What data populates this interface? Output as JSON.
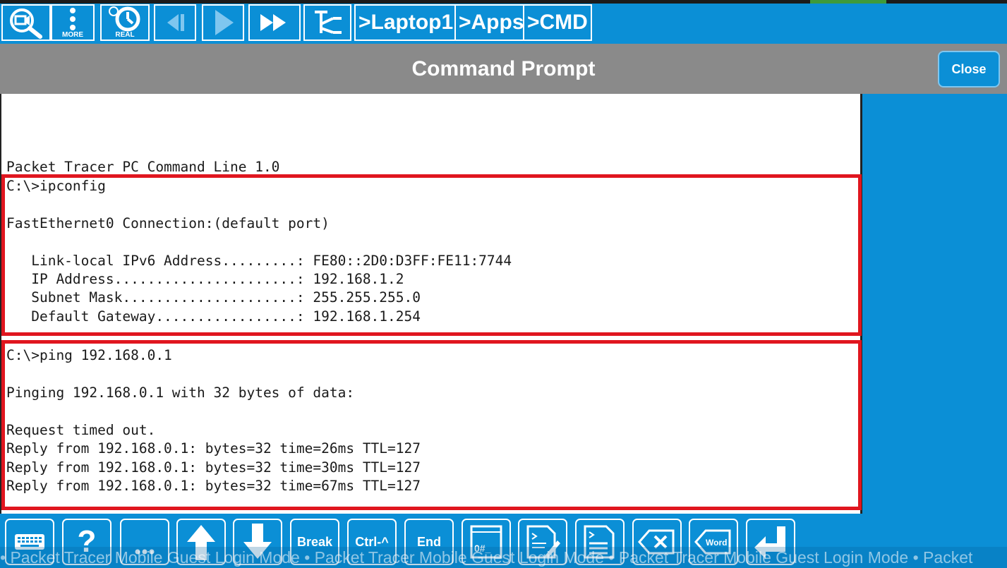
{
  "toolbar": {
    "buttons": [
      {
        "name": "inspect-button",
        "icon": "magnifier-icon"
      },
      {
        "name": "more-button",
        "icon": "vertical-dots-icon",
        "label": "MORE"
      },
      {
        "name": "realtime-button",
        "icon": "clock-icon",
        "label": "REAL"
      },
      {
        "name": "step-back-button",
        "icon": "step-back-icon"
      },
      {
        "name": "play-button",
        "icon": "play-icon"
      },
      {
        "name": "fast-forward-button",
        "icon": "fast-forward-icon"
      },
      {
        "name": "topology-button",
        "icon": "topology-icon"
      }
    ],
    "breadcrumbs": [
      ">Laptop1",
      ">Apps",
      ">CMD"
    ]
  },
  "titlebar": {
    "title": "Command Prompt",
    "close_label": "Close"
  },
  "terminal": {
    "header": "Packet Tracer PC Command Line 1.0",
    "ipconfig": [
      "C:\\>ipconfig",
      "",
      "FastEthernet0 Connection:(default port)",
      "",
      "   Link-local IPv6 Address.........: FE80::2D0:D3FF:FE11:7744",
      "   IP Address......................: 192.168.1.2",
      "   Subnet Mask.....................: 255.255.255.0",
      "   Default Gateway.................: 192.168.1.254"
    ],
    "ping": [
      "C:\\>ping 192.168.0.1",
      "",
      "Pinging 192.168.0.1 with 32 bytes of data:",
      "",
      "Request timed out.",
      "Reply from 192.168.0.1: bytes=32 time=26ms TTL=127",
      "Reply from 192.168.0.1: bytes=32 time=30ms TTL=127",
      "Reply from 192.168.0.1: bytes=32 time=67ms TTL=127"
    ]
  },
  "keybar": {
    "keys": [
      {
        "name": "keyboard-key",
        "icon": "keyboard-icon"
      },
      {
        "name": "help-key",
        "icon": "question-icon",
        "label": "?"
      },
      {
        "name": "more-key",
        "icon": "ellipsis-icon"
      },
      {
        "name": "up-arrow-key",
        "icon": "arrow-up-icon"
      },
      {
        "name": "down-arrow-key",
        "icon": "arrow-down-icon"
      },
      {
        "name": "break-key",
        "label": "Break"
      },
      {
        "name": "ctrl-key",
        "label": "Ctrl-^"
      },
      {
        "name": "end-key",
        "label": "End"
      },
      {
        "name": "hash-key",
        "icon": "terminal-hash-icon",
        "label": "0#_"
      },
      {
        "name": "edit-command-key",
        "icon": "terminal-edit-icon"
      },
      {
        "name": "command-list-key",
        "icon": "terminal-list-icon"
      },
      {
        "name": "backspace-key",
        "icon": "backspace-icon"
      },
      {
        "name": "delete-word-key",
        "icon": "delete-word-icon",
        "label": "Word"
      },
      {
        "name": "enter-key",
        "icon": "enter-icon"
      }
    ],
    "ticker": "• Packet Tracer Mobile Guest Login Mode • Packet Tracer Mobile Guest Login Mode • Packet Tracer Mobile Guest Login Mode • Packet"
  },
  "colors": {
    "background": "#0b8fd6",
    "titlebar": "#8a8a8a",
    "highlight_box": "#e0161f"
  }
}
